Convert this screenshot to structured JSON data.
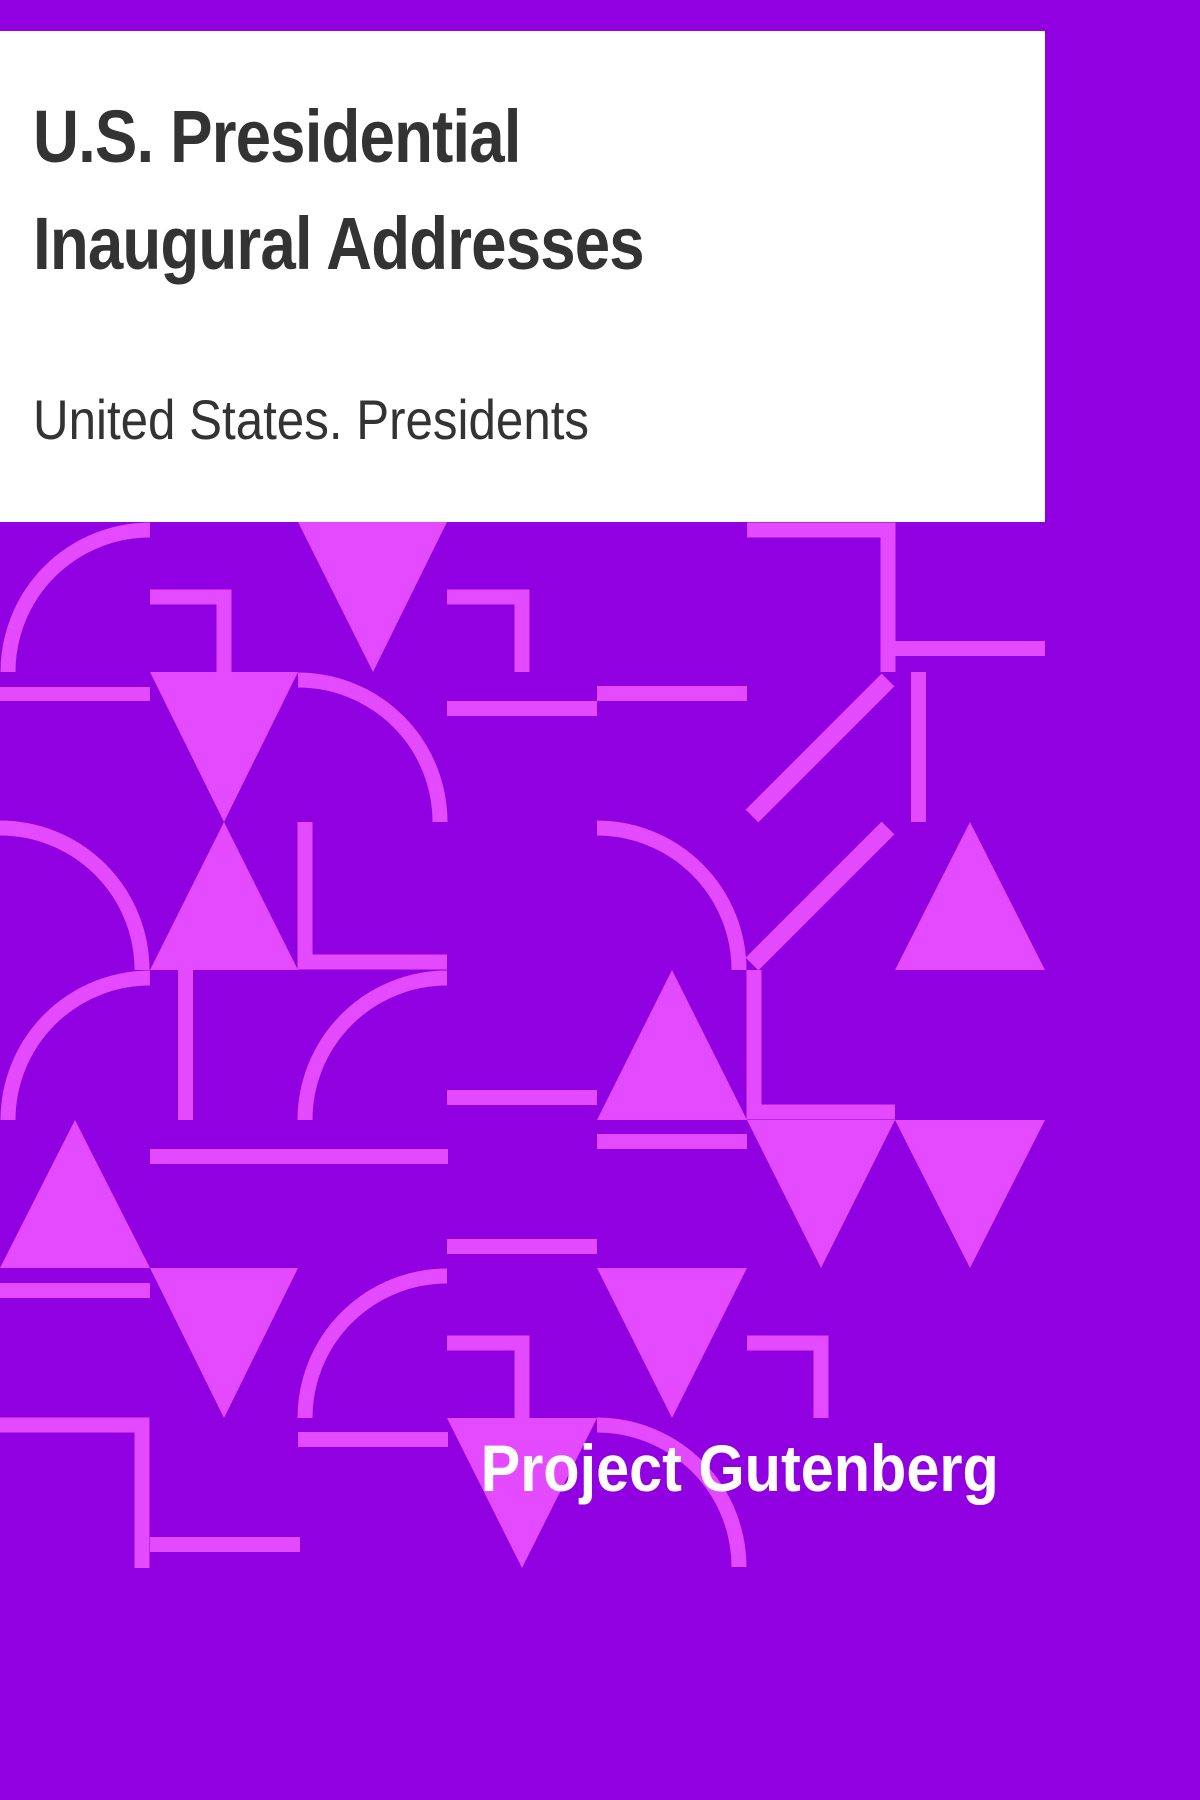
{
  "book": {
    "title": "U.S. Presidential Inaugural Addresses",
    "author": "United States. Presidents",
    "publisher": "Project Gutenberg"
  },
  "colors": {
    "background": "#9100e0",
    "pattern": "#e44aff",
    "title_panel": "#ffffff",
    "title_text": "#333333",
    "publisher_text": "#ffffff"
  }
}
